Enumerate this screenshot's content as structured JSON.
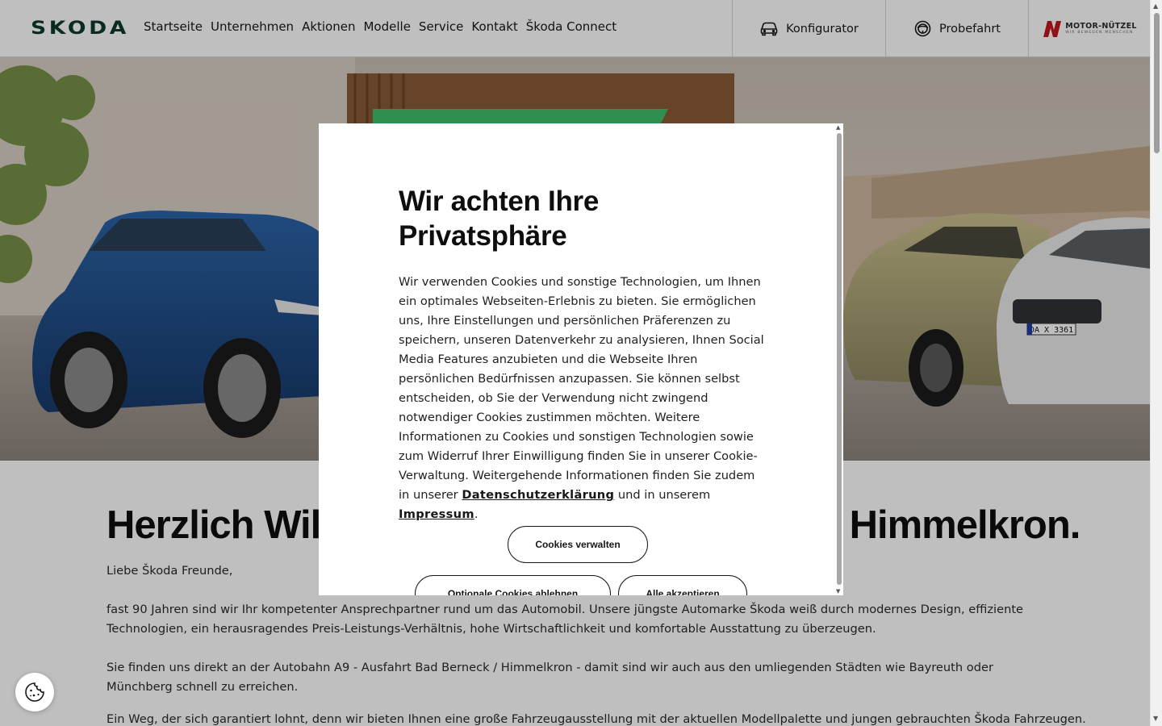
{
  "brand": {
    "logo_text": "SKODA",
    "color": "#0e3a2f",
    "accent": "#4ba82e"
  },
  "nav": {
    "items": [
      "Startseite",
      "Unternehmen",
      "Aktionen",
      "Modelle",
      "Service",
      "Kontakt",
      "Škoda Connect"
    ]
  },
  "header_actions": {
    "configurator": {
      "label": "Konfigurator",
      "icon": "car-icon"
    },
    "test_drive": {
      "label": "Probefahrt",
      "icon": "steering-wheel-icon"
    },
    "dealer": {
      "name": "MOTOR-NÜTZEL",
      "slogan": "WIR BEWEGEN MENSCHEN"
    }
  },
  "hero": {
    "license_plate": "DA X 3361",
    "banner_color": "#3fbf6b"
  },
  "content": {
    "title": "Herzlich Willkommen bei Motor-Nützel in Himmelkron.",
    "paragraphs": [
      "Liebe Škoda Freunde,",
      "fast 90 Jahren sind wir Ihr kompetenter Ansprechpartner rund um das Automobil. Unsere jüngste Automarke Škoda weiß durch modernes Design, effiziente Technologien, ein herausragendes Preis-Leistungs-Verhältnis, hohe Wirtschaftlichkeit und komfortable Ausstattung zu überzeugen.",
      "Sie finden uns direkt an der Autobahn A9 - Ausfahrt Bad Berneck / Himmelkron - damit sind wir auch aus den umliegenden Städten wie Bayreuth oder Münchberg schnell zu erreichen.",
      "Ein Weg, der sich garantiert lohnt, denn wir bieten Ihnen eine große Fahrzeugausstellung mit der aktuellen Modellpalette und jungen gebrauchten Škoda Fahrzeugen."
    ]
  },
  "cookie_modal": {
    "title": "Wir achten Ihre Privatsphäre",
    "body": "Wir verwenden Cookies und sonstige Technologien, um Ihnen ein optimales Webseiten-Erlebnis zu bieten. Sie ermöglichen uns, Ihre Einstellungen und persönlichen Präferenzen zu speichern, unseren Datenverkehr zu analysieren, Ihnen Social Media Features anzubieten und die Webseite Ihren persönlichen Bedürfnissen anzupassen. Sie können selbst entscheiden, ob Sie der Verwendung nicht zwingend notwendiger Cookies zustimmen möchten. Weitere Informationen zu Cookies und sonstigen Technologien sowie zum Widerruf Ihrer Einwilligung finden Sie in unserer Cookie-Verwaltung. Weitergehende Informationen finden Sie zudem in unserer",
    "link_privacy": "Datenschutzerklärung",
    "connector": "und in unserem",
    "link_imprint": "Impressum",
    "end": ".",
    "btn_manage": "Cookies verwalten",
    "btn_reject": "Optionale Cookies ablehnen",
    "btn_accept": "Alle akzeptieren"
  },
  "cookie_float": {
    "icon": "cookie-icon"
  }
}
